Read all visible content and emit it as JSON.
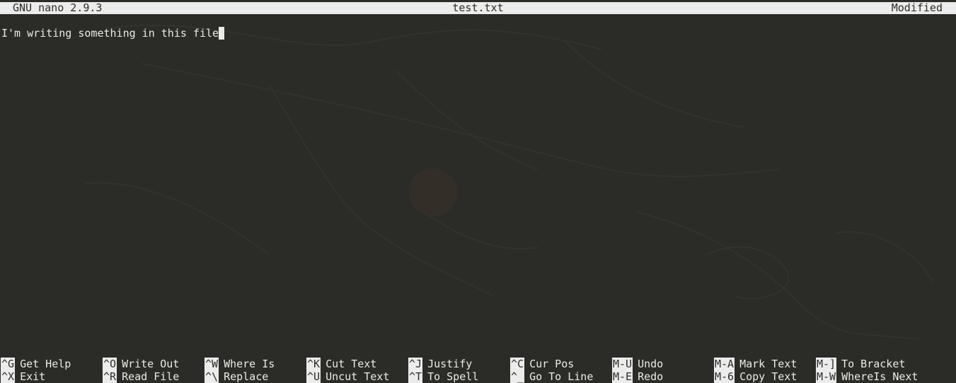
{
  "titlebar": {
    "app": "GNU nano 2.9.3",
    "filename": "test.txt",
    "status": "Modified"
  },
  "editor": {
    "content": "I'm writing something in this file"
  },
  "shortcuts": {
    "row1": [
      {
        "key": "^G",
        "label": "Get Help"
      },
      {
        "key": "^O",
        "label": "Write Out"
      },
      {
        "key": "^W",
        "label": "Where Is"
      },
      {
        "key": "^K",
        "label": "Cut Text"
      },
      {
        "key": "^J",
        "label": "Justify"
      },
      {
        "key": "^C",
        "label": "Cur Pos"
      },
      {
        "key": "M-U",
        "label": "Undo"
      },
      {
        "key": "M-A",
        "label": "Mark Text"
      },
      {
        "key": "M-]",
        "label": "To Bracket"
      }
    ],
    "row2": [
      {
        "key": "^X",
        "label": "Exit"
      },
      {
        "key": "^R",
        "label": "Read File"
      },
      {
        "key": "^\\",
        "label": "Replace"
      },
      {
        "key": "^U",
        "label": "Uncut Text"
      },
      {
        "key": "^T",
        "label": "To Spell"
      },
      {
        "key": "^_",
        "label": "Go To Line"
      },
      {
        "key": "M-E",
        "label": "Redo"
      },
      {
        "key": "M-6",
        "label": "Copy Text"
      },
      {
        "key": "M-W",
        "label": "WhereIs Next"
      }
    ]
  }
}
